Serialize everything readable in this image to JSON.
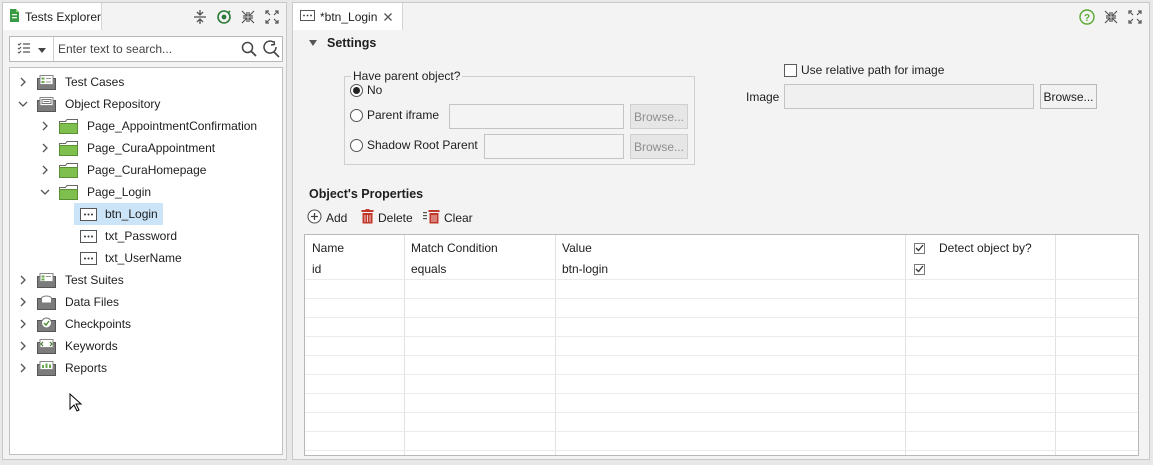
{
  "left_panel": {
    "tab_title": "Tests Explorer",
    "search_placeholder": "Enter text to search...",
    "tree": [
      {
        "label": "Test Cases",
        "icon": "test-cases-icon",
        "chevron": "right"
      },
      {
        "label": "Object Repository",
        "icon": "object-repository-icon",
        "chevron": "down"
      },
      {
        "label": "Page_AppointmentConfirmation",
        "icon": "folder-icon",
        "chevron": "right"
      },
      {
        "label": "Page_CuraAppointment",
        "icon": "folder-icon",
        "chevron": "right"
      },
      {
        "label": "Page_CuraHomepage",
        "icon": "folder-icon",
        "chevron": "right"
      },
      {
        "label": "Page_Login",
        "icon": "folder-icon",
        "chevron": "down"
      },
      {
        "label": "btn_Login",
        "icon": "web-element-icon",
        "selected": true
      },
      {
        "label": "txt_Password",
        "icon": "web-element-icon"
      },
      {
        "label": "txt_UserName",
        "icon": "web-element-icon"
      },
      {
        "label": "Test Suites",
        "icon": "test-suites-icon",
        "chevron": "right"
      },
      {
        "label": "Data Files",
        "icon": "data-files-icon",
        "chevron": "right"
      },
      {
        "label": "Checkpoints",
        "icon": "checkpoints-icon",
        "chevron": "right"
      },
      {
        "label": "Keywords",
        "icon": "keywords-icon",
        "chevron": "right"
      },
      {
        "label": "Reports",
        "icon": "reports-icon",
        "chevron": "right"
      }
    ]
  },
  "editor": {
    "tab_title": "*btn_Login",
    "settings_title": "Settings",
    "parent_group_legend": "Have parent object?",
    "radio_no": "No",
    "radio_parent_iframe": "Parent iframe",
    "radio_shadow_root": "Shadow Root Parent",
    "browse_label": "Browse...",
    "use_relative_path_label": "Use relative path for image",
    "image_label": "Image",
    "properties_title": "Object's Properties",
    "toolbar": {
      "add": "Add",
      "delete": "Delete",
      "clear": "Clear"
    },
    "table": {
      "columns": [
        "Name",
        "Match Condition",
        "Value",
        "Detect object by?"
      ],
      "rows": [
        {
          "name": "id",
          "match": "equals",
          "value": "btn-login",
          "detect": true
        }
      ]
    }
  },
  "colors": {
    "accent_blue": "#1b6fb3",
    "help_green": "#5aa832",
    "selection": "#cce4f7",
    "delete_red": "#c0392b"
  }
}
